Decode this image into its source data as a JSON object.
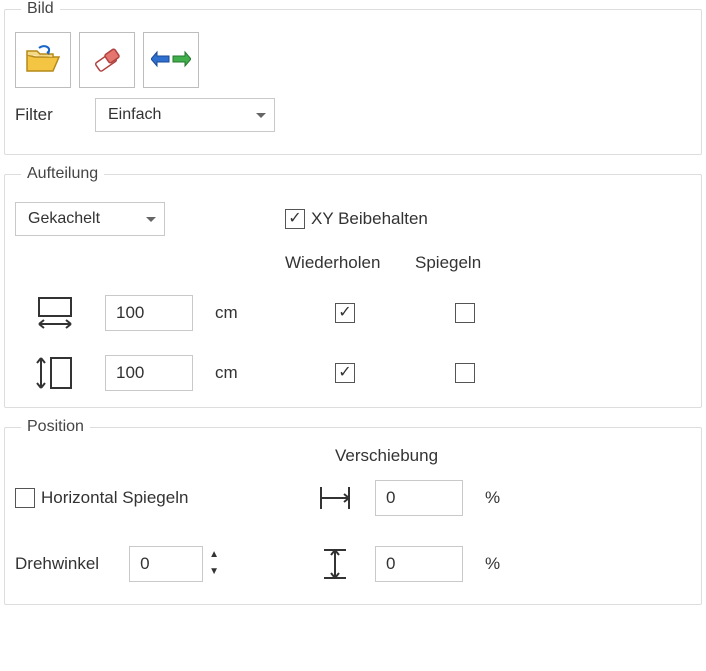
{
  "bild": {
    "legend": "Bild",
    "filter_label": "Filter",
    "filter_value": "Einfach"
  },
  "aufteilung": {
    "legend": "Aufteilung",
    "mode": "Gekachelt",
    "xy_keep_label": "XY Beibehalten",
    "xy_keep_checked": true,
    "hdr_repeat": "Wiederholen",
    "hdr_mirror": "Spiegeln",
    "width_value": "100",
    "width_unit": "cm",
    "width_repeat": true,
    "width_mirror": false,
    "height_value": "100",
    "height_unit": "cm",
    "height_repeat": true,
    "height_mirror": false
  },
  "position": {
    "legend": "Position",
    "shift_label": "Verschiebung",
    "hflip_label": "Horizontal Spiegeln",
    "hflip_checked": false,
    "shift_x_value": "0",
    "shift_x_unit": "%",
    "angle_label": "Drehwinkel",
    "angle_value": "0",
    "shift_y_value": "0",
    "shift_y_unit": "%"
  }
}
